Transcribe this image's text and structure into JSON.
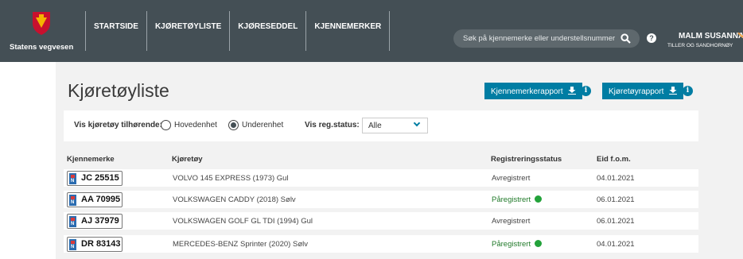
{
  "header": {
    "logo_text": "Statens vegvesen",
    "nav": [
      "STARTSIDE",
      "KJØRETØYLISTE",
      "KJØRESEDDEL",
      "KJENNEMERKER"
    ],
    "search_placeholder": "Søk på kjennemerke eller understellsnummer",
    "help_glyph": "?",
    "user_name": "MALM SUSANNA",
    "user_org": "TILLER OG SANDHORNØY"
  },
  "page": {
    "title": "Kjøretøyliste",
    "buttons": {
      "plates_report": "Kjennemerkerapport",
      "vehicle_report": "Kjøretøyrapport"
    },
    "info_glyph": "i"
  },
  "filter": {
    "owner_label": "Vis kjøretøy tilhørende:",
    "option_main": "Hovedenhet",
    "option_sub": "Underenhet",
    "selected": "Underenhet",
    "status_label": "Vis reg.status:",
    "status_value": "Alle"
  },
  "table": {
    "headers": [
      "Kjennemerke",
      "Kjøretøy",
      "Registreringsstatus",
      "Eid f.o.m."
    ],
    "plate_country": "N",
    "rows": [
      {
        "plate": "JC 25515",
        "vehicle": "VOLVO 145 EXPRESS (1973) Gul",
        "status": "Avregistrert",
        "active": false,
        "owned_from": "04.01.2021"
      },
      {
        "plate": "AA 70995",
        "vehicle": "VOLKSWAGEN CADDY (2018) Sølv",
        "status": "Påregistrert",
        "active": true,
        "owned_from": "06.01.2021"
      },
      {
        "plate": "AJ 37979",
        "vehicle": "VOLKSWAGEN GOLF GL TDI (1994) Gul",
        "status": "Avregistrert",
        "active": false,
        "owned_from": "06.01.2021"
      },
      {
        "plate": "DR 83143",
        "vehicle": "MERCEDES-BENZ Sprinter (2020) Sølv",
        "status": "Påregistrert",
        "active": true,
        "owned_from": "04.01.2021"
      }
    ]
  },
  "colors": {
    "header_bg": "#444f55",
    "accent": "#007da3",
    "active_dot": "#23a23a",
    "logo_red": "#c8102e",
    "logo_yellow": "#f5b400"
  }
}
